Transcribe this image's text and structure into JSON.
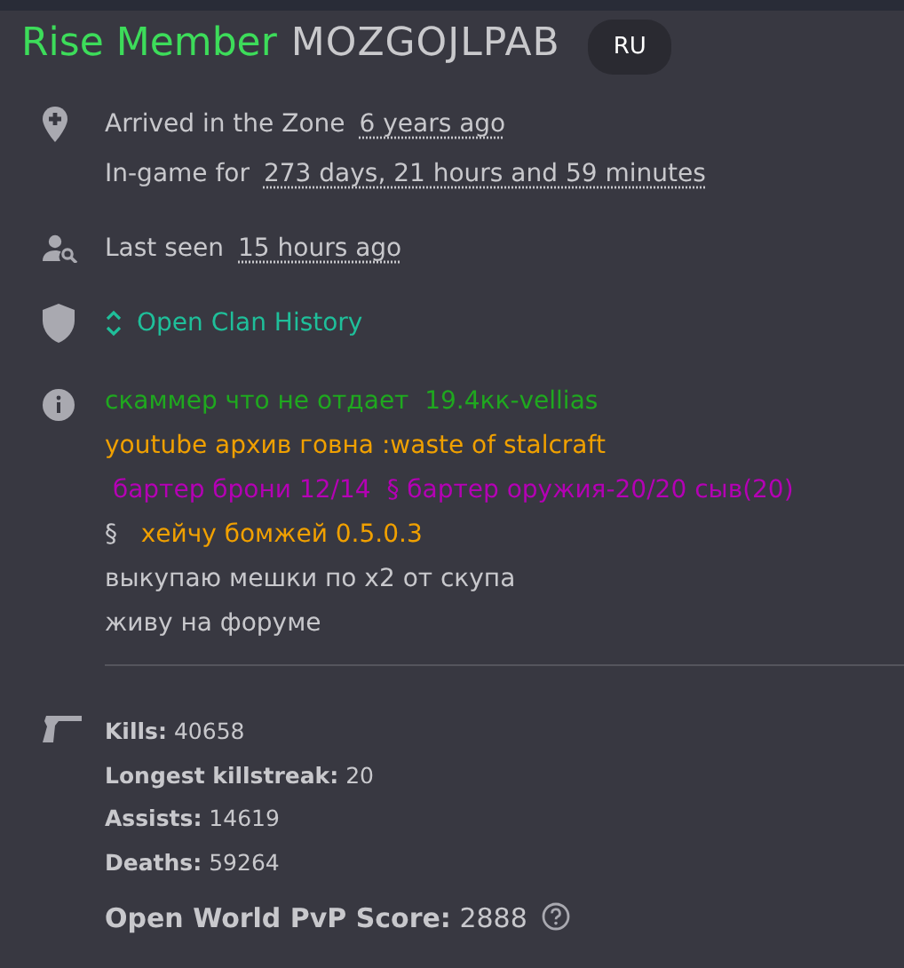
{
  "header": {
    "rank": "Rise Member",
    "name": "MOZGOJLPAB",
    "region": "RU"
  },
  "info": [
    {
      "kind": "pin",
      "label": "Arrived in the Zone",
      "value": "6 years ago"
    },
    {
      "kind": "none",
      "label": "In-game for",
      "value": "273 days, 21 hours and 59 minutes"
    },
    {
      "kind": "seen",
      "label": "Last seen",
      "value": "15 hours ago"
    }
  ],
  "clan": {
    "link": "Open Clan History"
  },
  "bio": [
    [
      {
        "text": "скаммер что не отдает  19.4кк-vellias",
        "color": "#1fa81f"
      }
    ],
    [
      {
        "text": "youtube архив говна :waste of stalcraft",
        "color": "#f0a000"
      }
    ],
    [
      {
        "text": " бартер брони 12/14  § бартер оружия-20/20 сыв(20)",
        "color": "#b400b4"
      }
    ],
    [
      {
        "text": "§  ",
        "color": "#c8c8cc"
      },
      {
        "text": " хейчу бомжей 0.5.0.3",
        "color": "#f0a000"
      }
    ],
    [
      {
        "text": "выкупаю мешки по x2 от скупа",
        "color": "#c8c8cc"
      }
    ],
    [
      {
        "text": "живу на форуме",
        "color": "#c8c8cc"
      }
    ]
  ],
  "stats": [
    {
      "label": "Kills:",
      "value": "40658"
    },
    {
      "label": "Longest killstreak:",
      "value": "20"
    },
    {
      "label": "Assists:",
      "value": "14619"
    },
    {
      "label": "Deaths:",
      "value": "59264"
    }
  ],
  "score": {
    "label": "Open World PvP Score:",
    "value": "2888"
  }
}
